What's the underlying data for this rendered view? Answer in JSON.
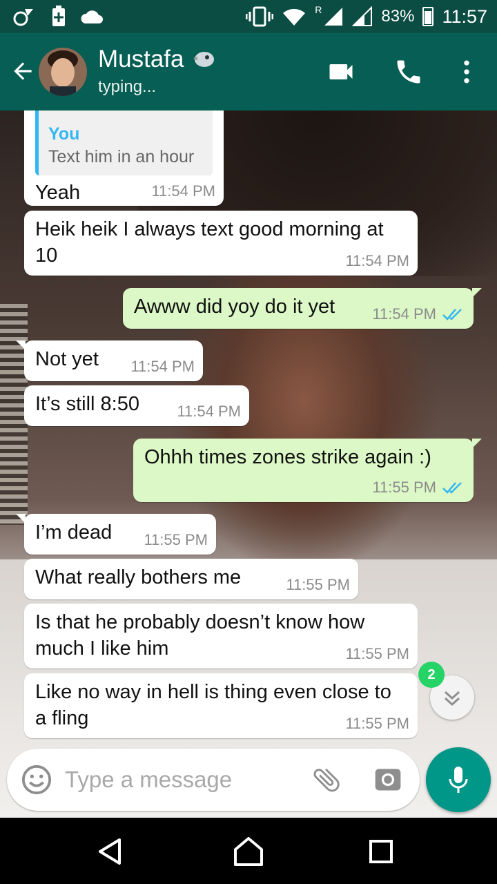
{
  "status_bar": {
    "signal_label": "R",
    "battery": "83%",
    "time": "11:57"
  },
  "header": {
    "contact_name": "Mustafa",
    "status": "typing..."
  },
  "messages": [
    {
      "dir": "in",
      "quote_author": "You",
      "quote_text": "Text him in an hour",
      "text": "Yeah",
      "time": "11:54 PM"
    },
    {
      "dir": "in",
      "text": "Heik heik I always text good morning at 10",
      "time": "11:54 PM"
    },
    {
      "dir": "out",
      "text": "Awww did yoy do it yet",
      "time": "11:54 PM"
    },
    {
      "dir": "in",
      "text": "Not yet",
      "time": "11:54 PM"
    },
    {
      "dir": "in",
      "text": "It’s still 8:50",
      "time": "11:54 PM"
    },
    {
      "dir": "out",
      "text": "Ohhh times zones strike again :)",
      "time": "11:55 PM"
    },
    {
      "dir": "in",
      "text": "I’m dead",
      "time": "11:55 PM"
    },
    {
      "dir": "in",
      "text": "What really bothers me",
      "time": "11:55 PM"
    },
    {
      "dir": "in",
      "text": "Is that he probably doesn’t know how much I like him",
      "time": "11:55 PM"
    },
    {
      "dir": "in",
      "text": "Like no way in hell is thing even close to a fling",
      "time": "11:55 PM"
    }
  ],
  "scroll": {
    "unread_count": "2"
  },
  "input": {
    "placeholder": "Type a message",
    "value": ""
  },
  "colors": {
    "header": "#075e54",
    "outgoing": "#dcf8c6",
    "incoming": "#ffffff",
    "accent": "#009688",
    "read_ticks": "#34b7f1"
  },
  "icons": [
    "back-arrow-icon",
    "video-call-icon",
    "phone-icon",
    "more-vert-icon",
    "emoji-icon",
    "attach-icon",
    "camera-icon",
    "mic-icon",
    "chevron-down-icon",
    "nav-back-icon",
    "nav-home-icon",
    "nav-recents-icon"
  ]
}
